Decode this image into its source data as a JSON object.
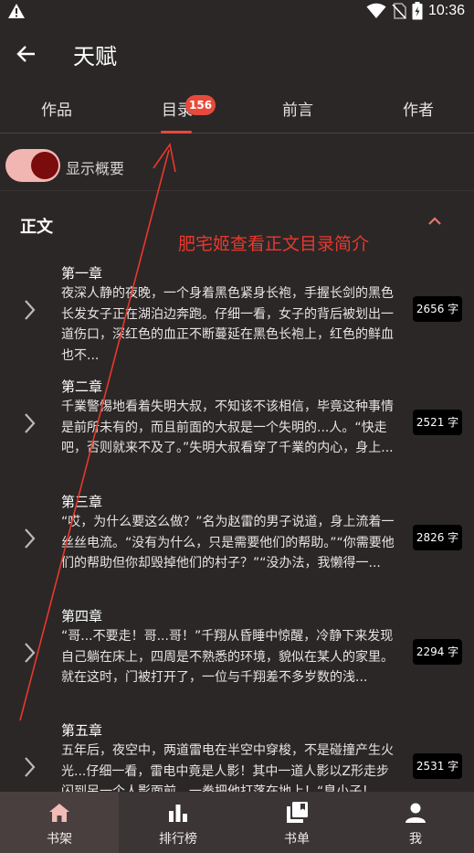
{
  "status_bar": {
    "time": "10:36"
  },
  "app_bar": {
    "title": "天赋"
  },
  "tabs": [
    {
      "label": "作品"
    },
    {
      "label": "目录",
      "badge": "156"
    },
    {
      "label": "前言"
    },
    {
      "label": "作者"
    }
  ],
  "summary_toggle": {
    "label": "显示概要",
    "on": true
  },
  "section": {
    "title": "正文"
  },
  "annotation": "肥宅姬查看正文目录简介",
  "chapters": [
    {
      "title": "第一章",
      "summary": "夜深人静的夜晚，一个身着黑色紧身长袍，手握长剑的黑色长发女子正在湖泊边奔跑。仔细一看，女子的背后被划出一道伤口，深红色的血正不断蔓延在黑色长袍上，红色的鲜血也不...",
      "count": "2656 字"
    },
    {
      "title": "第二章",
      "summary": "千業警惕地看着失明大叔，不知该不该相信，毕竟这种事情是前所未有的，而且前面的大叔是一个失明的...人。“快走吧，否则就来不及了。”失明大叔看穿了千業的内心，身上...",
      "count": "2521 字"
    },
    {
      "title": "第三章",
      "summary": "“哎，为什么要这么做？”名为赵雷的男子说道，身上流着一丝丝电流。“没有为什么，只是需要他们的帮助。”“你需要他们的帮助但你却毁掉他们的村子？”“没办法，我懒得一...",
      "count": "2826 字"
    },
    {
      "title": "第四章",
      "summary": "“哥...不要走！哥...哥！”千翔从昏睡中惊醒，冷静下来发现自己躺在床上，四周是不熟悉的环境，貌似在某人的家里。就在这时，门被打开了，一位与千翔差不多岁数的浅...",
      "count": "2294 字"
    },
    {
      "title": "第五章",
      "summary": "五年后，夜空中，两道雷电在半空中穿梭，不是碰撞产生火光...仔细一看，雷电中竟是人影！其中一道人影以Z形走步闪到另一个人影面前，一拳把他打落在地上！“臭小子！",
      "count": "2531 字"
    }
  ],
  "bottom_nav": [
    {
      "label": "书架",
      "icon": "home-icon",
      "active": true
    },
    {
      "label": "排行榜",
      "icon": "bar-chart-icon",
      "active": false
    },
    {
      "label": "书单",
      "icon": "book-list-icon",
      "active": false
    },
    {
      "label": "我",
      "icon": "person-icon",
      "active": false
    }
  ],
  "colors": {
    "accent": "#e74a3b",
    "background": "#2b2727",
    "nav_background": "#3b3535",
    "toggle_track": "#f2b6b2",
    "toggle_knob": "#7a0c0c",
    "annotation": "#e8382d"
  }
}
